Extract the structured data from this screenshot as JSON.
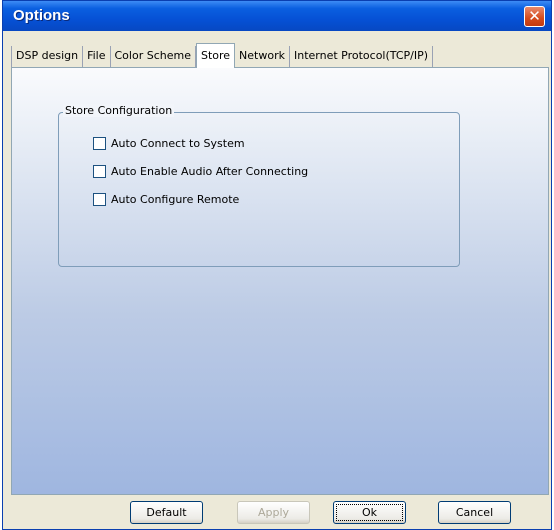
{
  "window": {
    "title": "Options",
    "close_glyph": "✕"
  },
  "tabs": [
    {
      "label": "DSP design"
    },
    {
      "label": "File"
    },
    {
      "label": "Color Scheme"
    },
    {
      "label": "Store",
      "active": true
    },
    {
      "label": "Network"
    },
    {
      "label": "Internet Protocol(TCP/IP)"
    }
  ],
  "store_configuration": {
    "group_title": "Store Configuration",
    "options": [
      {
        "label": "Auto Connect to System",
        "checked": false
      },
      {
        "label": "Auto Enable Audio After Connecting",
        "checked": false
      },
      {
        "label": "Auto Configure Remote",
        "checked": false
      }
    ]
  },
  "buttons": {
    "default_label": "Default",
    "apply_label": "Apply",
    "ok_label": "Ok",
    "cancel_label": "Cancel",
    "apply_enabled": false
  },
  "colors": {
    "titlebar": "#0651d6",
    "panel_bottom": "#9fb6e0"
  }
}
